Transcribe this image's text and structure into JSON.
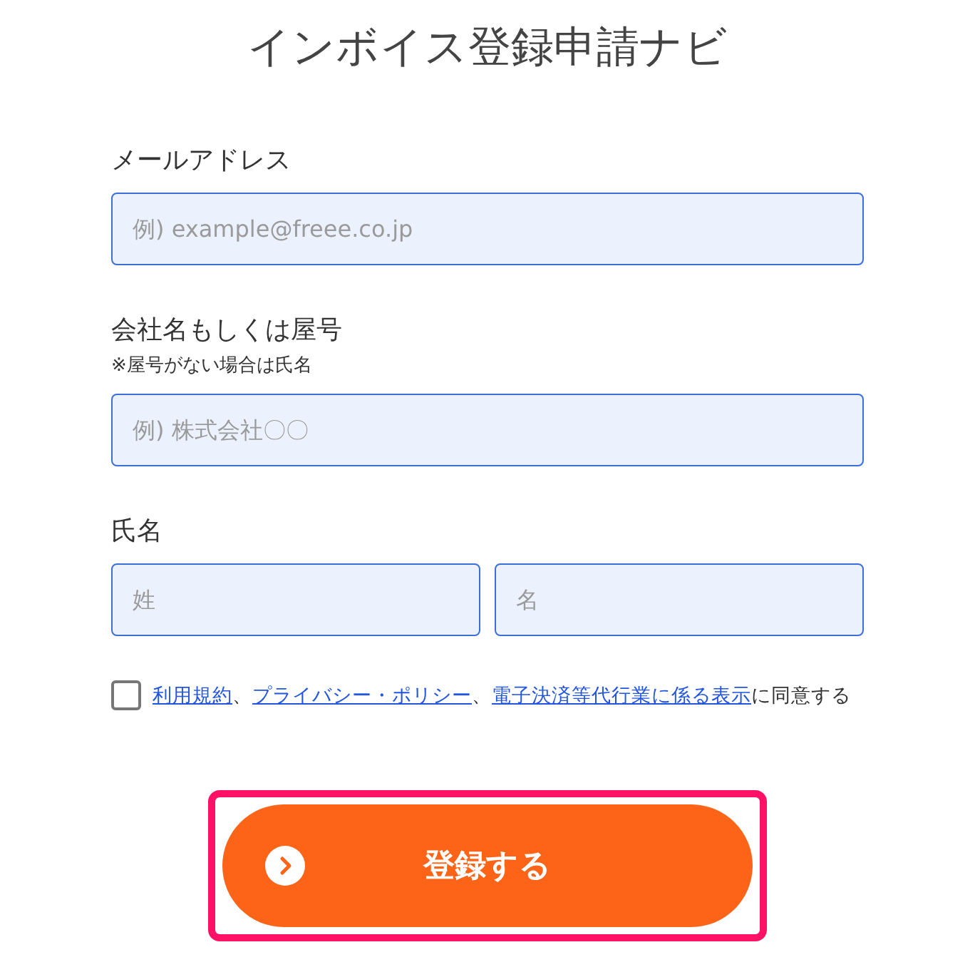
{
  "title": "インボイス登録申請ナビ",
  "fields": [
    {
      "label": "メールアドレス",
      "inputs": [
        {
          "placeholder": "例) example@freee.co.jp"
        }
      ]
    },
    {
      "label": "会社名もしくは屋号",
      "note": "※屋号がない場合は氏名",
      "inputs": [
        {
          "placeholder": "例) 株式会社〇〇"
        }
      ]
    },
    {
      "label": "氏名",
      "inputs": [
        {
          "placeholder": "姓"
        },
        {
          "placeholder": "名"
        }
      ]
    }
  ],
  "agreement": {
    "checked": false,
    "parts": [
      {
        "kind": "link",
        "text": "利用規約"
      },
      {
        "kind": "text",
        "text": "、"
      },
      {
        "kind": "link",
        "text": "プライバシー・ポリシー"
      },
      {
        "kind": "text",
        "text": "、"
      },
      {
        "kind": "link",
        "text": "電子決済等代行業に係る表示"
      },
      {
        "kind": "text",
        "text": "に同意する"
      }
    ]
  },
  "submit": {
    "label": "登録する",
    "highlighted": true
  }
}
